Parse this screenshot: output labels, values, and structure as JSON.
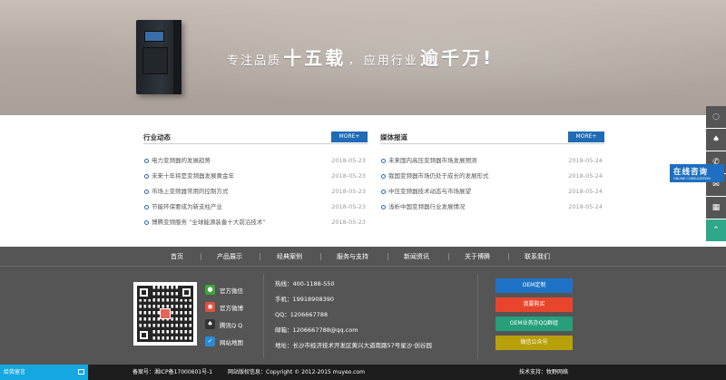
{
  "banner": {
    "slogan_small_1": "专注品质",
    "slogan_big_1": "十五载",
    "slogan_comma": "，",
    "slogan_small_2": "应用行业",
    "slogan_big_2": "逾千万!"
  },
  "news_left": {
    "title": "行业动态",
    "more": "MORE+",
    "items": [
      {
        "text": "电力变频器的发展趋势",
        "date": "2018-05-23"
      },
      {
        "text": "未来十年将是变频器发展黄金年",
        "date": "2018-05-23"
      },
      {
        "text": "市场上变频器常用的控制方式",
        "date": "2018-05-23"
      },
      {
        "text": "节能环保要成为新支柱产业",
        "date": "2018-05-23"
      },
      {
        "text": "博腾变频服务 “全球能源装备十大前沿技术”",
        "date": "2018-05-23"
      }
    ]
  },
  "news_right": {
    "title": "媒体报道",
    "more": "MORE+",
    "items": [
      {
        "text": "未来国内高压变频器市场发展预测",
        "date": "2018-05-24"
      },
      {
        "text": "我国变频器市场仍处于成长的发展形式",
        "date": "2018-05-24"
      },
      {
        "text": "中压变频器技术动态与市场展望",
        "date": "2018-05-24"
      },
      {
        "text": "浅析中国变频器行业发展情况",
        "date": "2018-05-24"
      }
    ]
  },
  "float_bar": {
    "consult_title": "在线咨询",
    "consult_sub": "ONLINE CONSULTATION"
  },
  "footer_nav": [
    "首页",
    "产品展示",
    "经典案例",
    "服务与支持",
    "新闻资讯",
    "关于博腾",
    "联系我们"
  ],
  "social": [
    {
      "label": "官方微信",
      "color": "#3aa83a",
      "icon": "wechat-icon"
    },
    {
      "label": "官方微博",
      "color": "#e0503c",
      "icon": "weibo-icon"
    },
    {
      "label": "腾讯Q Q",
      "color": "#333333",
      "icon": "qq-icon"
    },
    {
      "label": "网站地图",
      "color": "#2a8ad8",
      "icon": "sitemap-icon"
    }
  ],
  "contact": {
    "hotline": "热线：400-1188-550",
    "phone": "手机：19918908390",
    "qq": "QQ：1206667788",
    "email": "邮箱：1206667788@qq.com",
    "address": "地址：长沙市经济技术开发区黄兴大道南路57号星沙·创谷园"
  },
  "buttons": [
    {
      "label": "OEM定制",
      "color": "#1e73c8"
    },
    {
      "label": "我要购买",
      "color": "#e8452c"
    },
    {
      "label": "OEM业务办QQ群组",
      "color": "#26a07a"
    },
    {
      "label": "微信公众号",
      "color": "#b7a00a"
    }
  ],
  "bottom": {
    "message": "给我留言",
    "icp": "备案号：湘ICP备17000601号-1",
    "copyright": "网站版权信息：Copyright © 2012-2015 muyeo.com",
    "support": "技术支持：牧野网络"
  }
}
